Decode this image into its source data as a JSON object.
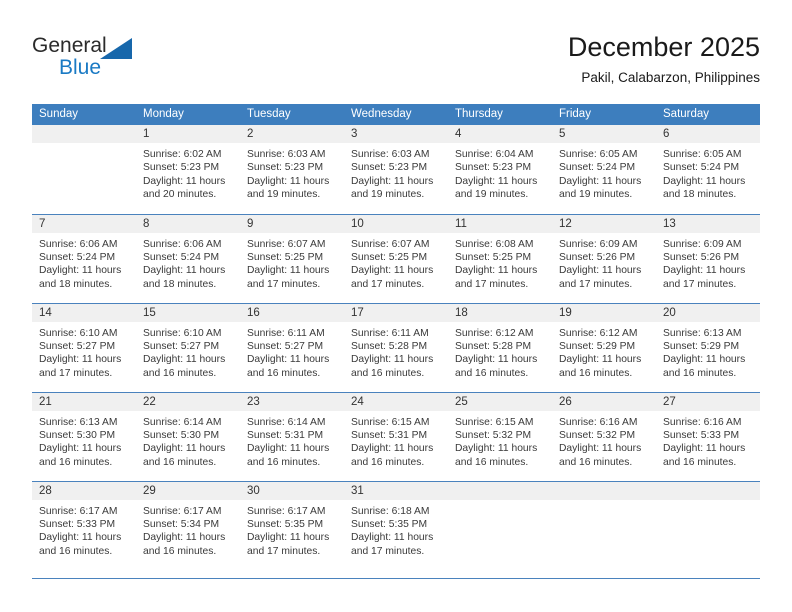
{
  "logo": {
    "word_one": "General",
    "word_two": "Blue",
    "triangle_color": "#1767ab",
    "blue_color": "#1a7ac4"
  },
  "header": {
    "title": "December 2025",
    "subtitle": "Pakil, Calabarzon, Philippines"
  },
  "theme": {
    "header_bg": "#3d7ebe",
    "daynum_bg": "#f0f0f0",
    "rule_color": "#4a82bd",
    "text_color": "#3a3a3a"
  },
  "weekdays": [
    "Sunday",
    "Monday",
    "Tuesday",
    "Wednesday",
    "Thursday",
    "Friday",
    "Saturday"
  ],
  "weeks": [
    [
      {
        "day": "",
        "sunrise": "",
        "sunset": "",
        "daylight_1": "",
        "daylight_2": ""
      },
      {
        "day": "1",
        "sunrise": "Sunrise: 6:02 AM",
        "sunset": "Sunset: 5:23 PM",
        "daylight_1": "Daylight: 11 hours",
        "daylight_2": "and 20 minutes."
      },
      {
        "day": "2",
        "sunrise": "Sunrise: 6:03 AM",
        "sunset": "Sunset: 5:23 PM",
        "daylight_1": "Daylight: 11 hours",
        "daylight_2": "and 19 minutes."
      },
      {
        "day": "3",
        "sunrise": "Sunrise: 6:03 AM",
        "sunset": "Sunset: 5:23 PM",
        "daylight_1": "Daylight: 11 hours",
        "daylight_2": "and 19 minutes."
      },
      {
        "day": "4",
        "sunrise": "Sunrise: 6:04 AM",
        "sunset": "Sunset: 5:23 PM",
        "daylight_1": "Daylight: 11 hours",
        "daylight_2": "and 19 minutes."
      },
      {
        "day": "5",
        "sunrise": "Sunrise: 6:05 AM",
        "sunset": "Sunset: 5:24 PM",
        "daylight_1": "Daylight: 11 hours",
        "daylight_2": "and 19 minutes."
      },
      {
        "day": "6",
        "sunrise": "Sunrise: 6:05 AM",
        "sunset": "Sunset: 5:24 PM",
        "daylight_1": "Daylight: 11 hours",
        "daylight_2": "and 18 minutes."
      }
    ],
    [
      {
        "day": "7",
        "sunrise": "Sunrise: 6:06 AM",
        "sunset": "Sunset: 5:24 PM",
        "daylight_1": "Daylight: 11 hours",
        "daylight_2": "and 18 minutes."
      },
      {
        "day": "8",
        "sunrise": "Sunrise: 6:06 AM",
        "sunset": "Sunset: 5:24 PM",
        "daylight_1": "Daylight: 11 hours",
        "daylight_2": "and 18 minutes."
      },
      {
        "day": "9",
        "sunrise": "Sunrise: 6:07 AM",
        "sunset": "Sunset: 5:25 PM",
        "daylight_1": "Daylight: 11 hours",
        "daylight_2": "and 17 minutes."
      },
      {
        "day": "10",
        "sunrise": "Sunrise: 6:07 AM",
        "sunset": "Sunset: 5:25 PM",
        "daylight_1": "Daylight: 11 hours",
        "daylight_2": "and 17 minutes."
      },
      {
        "day": "11",
        "sunrise": "Sunrise: 6:08 AM",
        "sunset": "Sunset: 5:25 PM",
        "daylight_1": "Daylight: 11 hours",
        "daylight_2": "and 17 minutes."
      },
      {
        "day": "12",
        "sunrise": "Sunrise: 6:09 AM",
        "sunset": "Sunset: 5:26 PM",
        "daylight_1": "Daylight: 11 hours",
        "daylight_2": "and 17 minutes."
      },
      {
        "day": "13",
        "sunrise": "Sunrise: 6:09 AM",
        "sunset": "Sunset: 5:26 PM",
        "daylight_1": "Daylight: 11 hours",
        "daylight_2": "and 17 minutes."
      }
    ],
    [
      {
        "day": "14",
        "sunrise": "Sunrise: 6:10 AM",
        "sunset": "Sunset: 5:27 PM",
        "daylight_1": "Daylight: 11 hours",
        "daylight_2": "and 17 minutes."
      },
      {
        "day": "15",
        "sunrise": "Sunrise: 6:10 AM",
        "sunset": "Sunset: 5:27 PM",
        "daylight_1": "Daylight: 11 hours",
        "daylight_2": "and 16 minutes."
      },
      {
        "day": "16",
        "sunrise": "Sunrise: 6:11 AM",
        "sunset": "Sunset: 5:27 PM",
        "daylight_1": "Daylight: 11 hours",
        "daylight_2": "and 16 minutes."
      },
      {
        "day": "17",
        "sunrise": "Sunrise: 6:11 AM",
        "sunset": "Sunset: 5:28 PM",
        "daylight_1": "Daylight: 11 hours",
        "daylight_2": "and 16 minutes."
      },
      {
        "day": "18",
        "sunrise": "Sunrise: 6:12 AM",
        "sunset": "Sunset: 5:28 PM",
        "daylight_1": "Daylight: 11 hours",
        "daylight_2": "and 16 minutes."
      },
      {
        "day": "19",
        "sunrise": "Sunrise: 6:12 AM",
        "sunset": "Sunset: 5:29 PM",
        "daylight_1": "Daylight: 11 hours",
        "daylight_2": "and 16 minutes."
      },
      {
        "day": "20",
        "sunrise": "Sunrise: 6:13 AM",
        "sunset": "Sunset: 5:29 PM",
        "daylight_1": "Daylight: 11 hours",
        "daylight_2": "and 16 minutes."
      }
    ],
    [
      {
        "day": "21",
        "sunrise": "Sunrise: 6:13 AM",
        "sunset": "Sunset: 5:30 PM",
        "daylight_1": "Daylight: 11 hours",
        "daylight_2": "and 16 minutes."
      },
      {
        "day": "22",
        "sunrise": "Sunrise: 6:14 AM",
        "sunset": "Sunset: 5:30 PM",
        "daylight_1": "Daylight: 11 hours",
        "daylight_2": "and 16 minutes."
      },
      {
        "day": "23",
        "sunrise": "Sunrise: 6:14 AM",
        "sunset": "Sunset: 5:31 PM",
        "daylight_1": "Daylight: 11 hours",
        "daylight_2": "and 16 minutes."
      },
      {
        "day": "24",
        "sunrise": "Sunrise: 6:15 AM",
        "sunset": "Sunset: 5:31 PM",
        "daylight_1": "Daylight: 11 hours",
        "daylight_2": "and 16 minutes."
      },
      {
        "day": "25",
        "sunrise": "Sunrise: 6:15 AM",
        "sunset": "Sunset: 5:32 PM",
        "daylight_1": "Daylight: 11 hours",
        "daylight_2": "and 16 minutes."
      },
      {
        "day": "26",
        "sunrise": "Sunrise: 6:16 AM",
        "sunset": "Sunset: 5:32 PM",
        "daylight_1": "Daylight: 11 hours",
        "daylight_2": "and 16 minutes."
      },
      {
        "day": "27",
        "sunrise": "Sunrise: 6:16 AM",
        "sunset": "Sunset: 5:33 PM",
        "daylight_1": "Daylight: 11 hours",
        "daylight_2": "and 16 minutes."
      }
    ],
    [
      {
        "day": "28",
        "sunrise": "Sunrise: 6:17 AM",
        "sunset": "Sunset: 5:33 PM",
        "daylight_1": "Daylight: 11 hours",
        "daylight_2": "and 16 minutes."
      },
      {
        "day": "29",
        "sunrise": "Sunrise: 6:17 AM",
        "sunset": "Sunset: 5:34 PM",
        "daylight_1": "Daylight: 11 hours",
        "daylight_2": "and 16 minutes."
      },
      {
        "day": "30",
        "sunrise": "Sunrise: 6:17 AM",
        "sunset": "Sunset: 5:35 PM",
        "daylight_1": "Daylight: 11 hours",
        "daylight_2": "and 17 minutes."
      },
      {
        "day": "31",
        "sunrise": "Sunrise: 6:18 AM",
        "sunset": "Sunset: 5:35 PM",
        "daylight_1": "Daylight: 11 hours",
        "daylight_2": "and 17 minutes."
      },
      {
        "day": "",
        "sunrise": "",
        "sunset": "",
        "daylight_1": "",
        "daylight_2": ""
      },
      {
        "day": "",
        "sunrise": "",
        "sunset": "",
        "daylight_1": "",
        "daylight_2": ""
      },
      {
        "day": "",
        "sunrise": "",
        "sunset": "",
        "daylight_1": "",
        "daylight_2": ""
      }
    ]
  ]
}
